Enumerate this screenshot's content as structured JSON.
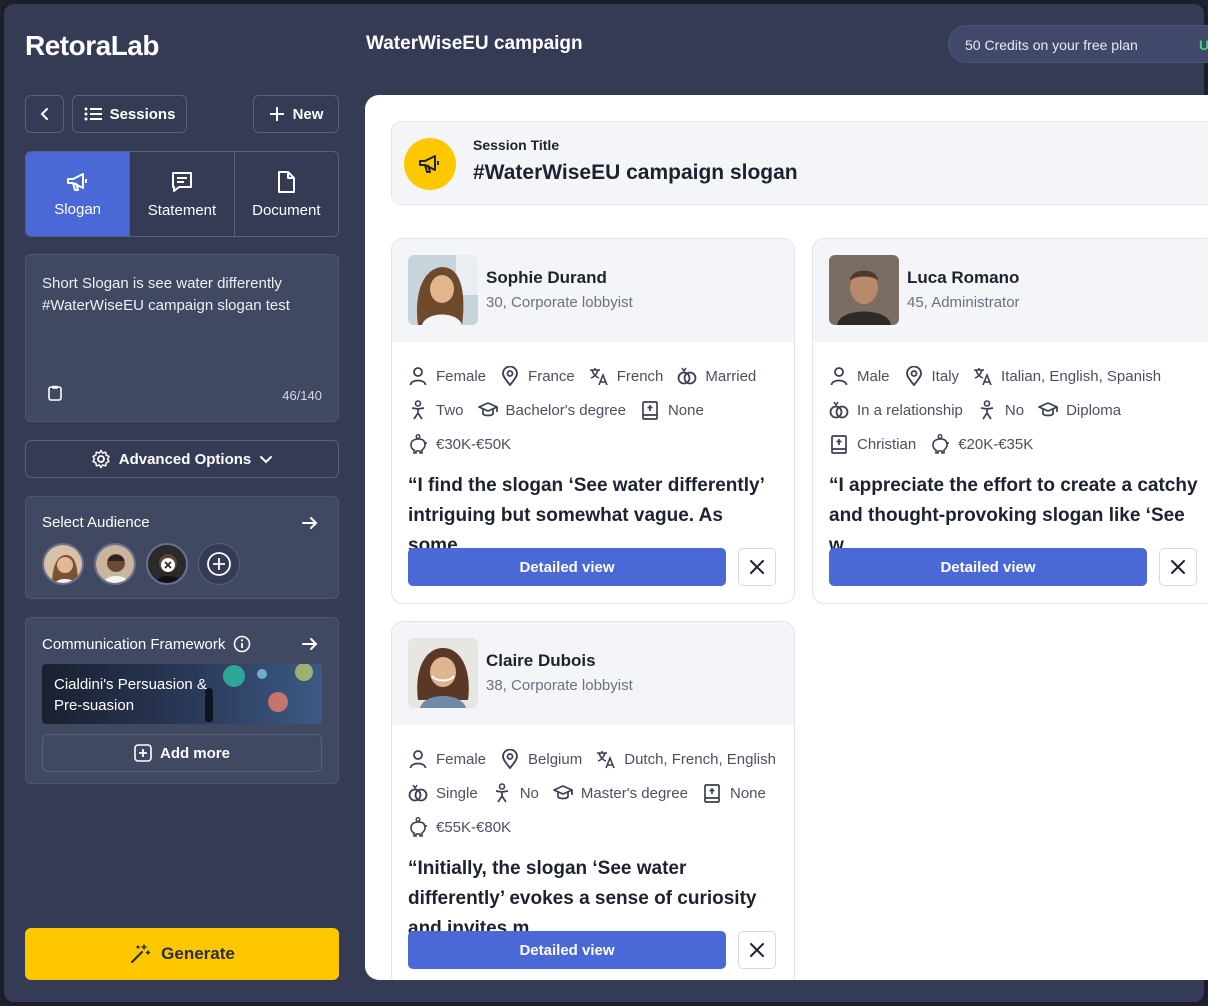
{
  "app": {
    "logo": "RetoraLab",
    "page_title": "WaterWiseEU campaign",
    "credits": "50 Credits on your free plan",
    "credits_upgrade": "U"
  },
  "sidebar": {
    "sessions_label": "Sessions",
    "new_label": "New",
    "tabs": [
      {
        "label": "Slogan",
        "icon": "megaphone-icon",
        "active": true
      },
      {
        "label": "Statement",
        "icon": "message-icon",
        "active": false
      },
      {
        "label": "Document",
        "icon": "document-icon",
        "active": false
      }
    ],
    "slogan_text": "Short Slogan is see water differently #WaterWiseEU campaign slogan test",
    "char_count": "46/140",
    "advanced_options": "Advanced Options",
    "audience_title": "Select Audience",
    "framework_title": "Communication Framework",
    "framework_card": "Cialdini's Persuasion & Pre-suasion",
    "add_more": "Add more",
    "generate": "Generate"
  },
  "session": {
    "label": "Session Title",
    "title": "#WaterWiseEU campaign slogan"
  },
  "personas": [
    {
      "name": "Sophie Durand",
      "sub": "30, Corporate lobbyist",
      "lines": [
        [
          [
            "user-icon",
            "Female"
          ],
          [
            "location-icon",
            "France"
          ],
          [
            "translate-icon",
            "French"
          ],
          [
            "rings-icon",
            "Married"
          ]
        ],
        [
          [
            "children-icon",
            "Two"
          ],
          [
            "graduation-icon",
            "Bachelor's degree"
          ],
          [
            "book-icon",
            "None"
          ]
        ],
        [
          [
            "piggy-bank-icon",
            "€30K-€50K"
          ]
        ]
      ],
      "quote": "“I find the slogan ‘See water differently’ intriguing but somewhat vague. As some...",
      "button": "Detailed view"
    },
    {
      "name": "Luca Romano",
      "sub": "45, Administrator",
      "lines": [
        [
          [
            "user-icon",
            "Male"
          ],
          [
            "location-icon",
            "Italy"
          ],
          [
            "translate-icon",
            "Italian, English, Spanish"
          ]
        ],
        [
          [
            "rings-icon",
            "In a relationship"
          ],
          [
            "children-icon",
            "No"
          ],
          [
            "graduation-icon",
            "Diploma"
          ]
        ],
        [
          [
            "book-icon",
            "Christian"
          ],
          [
            "piggy-bank-icon",
            "€20K-€35K"
          ]
        ]
      ],
      "quote": "“I appreciate the effort to create a catchy and thought-provoking slogan like ‘See w...",
      "button": "Detailed view"
    },
    {
      "name": "Claire Dubois",
      "sub": "38, Corporate lobbyist",
      "lines": [
        [
          [
            "user-icon",
            "Female"
          ],
          [
            "location-icon",
            "Belgium"
          ],
          [
            "translate-icon",
            "Dutch, French, English"
          ]
        ],
        [
          [
            "rings-icon",
            "Single"
          ],
          [
            "children-icon",
            "No"
          ],
          [
            "graduation-icon",
            "Master's degree"
          ],
          [
            "book-icon",
            "None"
          ]
        ],
        [
          [
            "piggy-bank-icon",
            "€55K-€80K"
          ]
        ]
      ],
      "quote": "“Initially, the slogan ‘See water differently’ evokes a sense of curiosity and invites m...",
      "button": "Detailed view"
    }
  ],
  "colors": {
    "sidebar_bg": "#353b54",
    "accent_blue": "#4a69d6",
    "accent_yellow": "#ffc700"
  }
}
